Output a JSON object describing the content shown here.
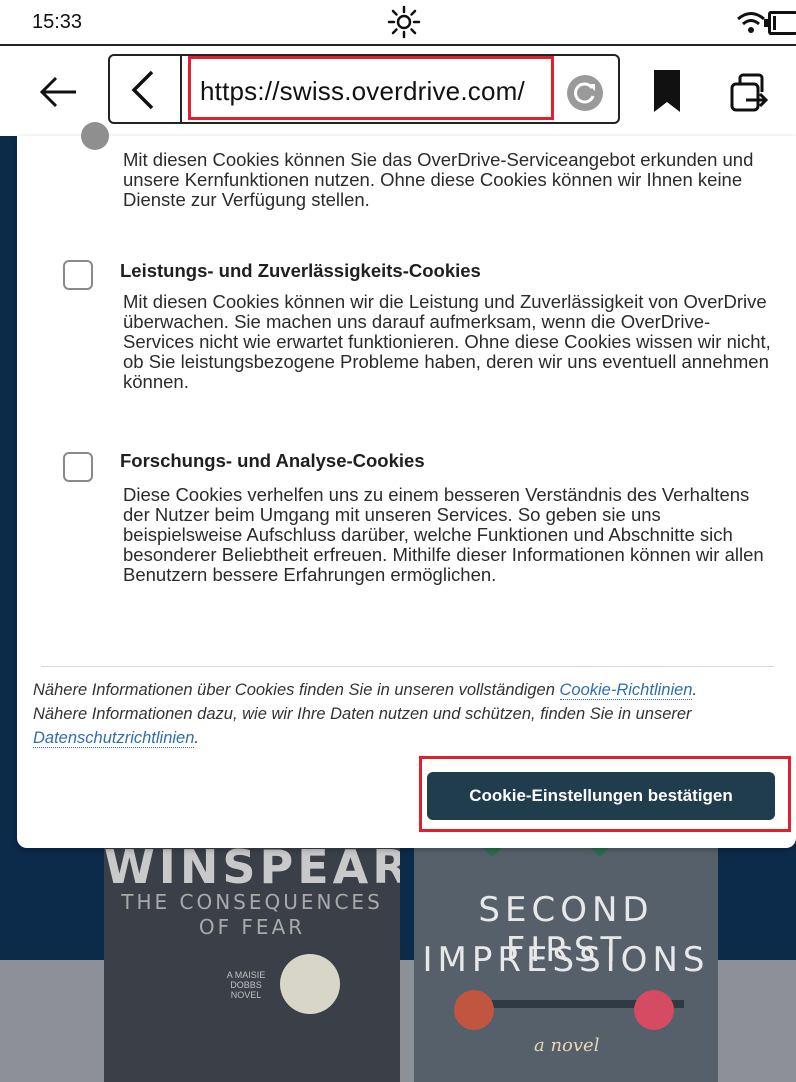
{
  "status_bar": {
    "time": "15:33"
  },
  "toolbar": {
    "url": "https://swiss.overdrive.com/"
  },
  "modal": {
    "intro_description": "Mit diesen Cookies können Sie das OverDrive-Serviceangebot erkunden und unsere Kernfunktionen nutzen. Ohne diese Cookies können wir Ihnen keine Dienste zur Verfügung stellen.",
    "categories": [
      {
        "title": "Leistungs- und Zuverlässigkeits-Cookies",
        "description": "Mit diesen Cookies können wir die Leistung und Zuverlässigkeit von OverDrive überwachen. Sie machen uns darauf aufmerksam, wenn die OverDrive-Services nicht wie erwartet funktionieren. Ohne diese Cookies wissen wir nicht, ob Sie leistungsbezogene Probleme haben, deren wir uns eventuell annehmen können.",
        "checked": false
      },
      {
        "title": "Forschungs- und Analyse-Cookies",
        "description": "Diese Cookies verhelfen uns zu einem besseren Verständnis des Verhaltens der Nutzer beim Umgang mit unseren Services. So geben sie uns beispielsweise Aufschluss darüber, welche Funktionen und Abschnitte sich besonderer Beliebtheit erfreuen. Mithilfe dieser Informationen können wir allen Benutzern bessere Erfahrungen ermöglichen.",
        "checked": false
      }
    ],
    "info": {
      "text_before": "Nähere Informationen über Cookies finden Sie in unseren vollständigen ",
      "cookie_link": "Cookie-Richtlinien",
      "text_middle": ". Nähere Informationen dazu, wie wir Ihre Daten nutzen und schützen, finden Sie in unserer ",
      "privacy_link": "Datenschutzrichtlinien",
      "text_after": "."
    },
    "confirm_button": "Cookie-Einstellungen bestätigen"
  },
  "background": {
    "book1": {
      "author": "WINSPEAR",
      "title_line1": "THE CONSEQUENCES",
      "title_line2": "OF FEAR",
      "tag": "A MAISIE DOBBS NOVEL"
    },
    "book2": {
      "title_line1": "SECOND FIRST",
      "title_line2": "IMPRESSIONS",
      "tag": "a novel"
    }
  },
  "colors": {
    "highlight": "#e0202c",
    "button_bg": "#1f3d4d",
    "link": "#2d6fb0",
    "page_bg": "#0c2a4a"
  }
}
